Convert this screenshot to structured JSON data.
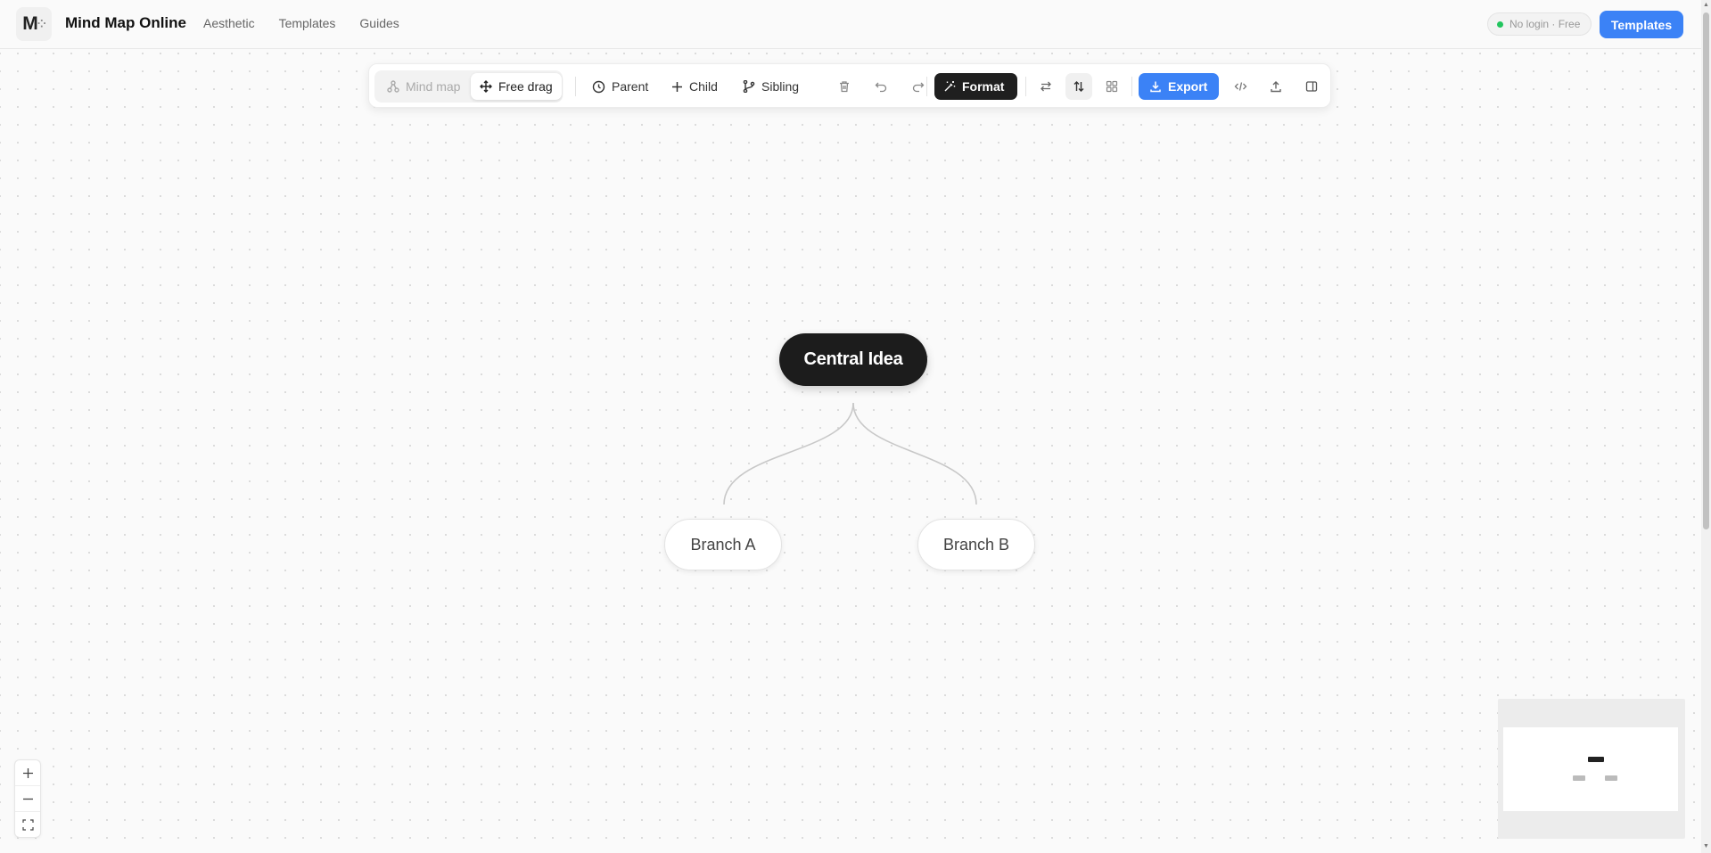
{
  "header": {
    "logo_letter": "M",
    "app_title": "Mind Map Online",
    "nav": [
      "Aesthetic",
      "Templates",
      "Guides"
    ],
    "status": "No login · Free",
    "templates_button": "Templates"
  },
  "toolbar": {
    "mode_mindmap": "Mind map",
    "mode_freedrag": "Free drag",
    "parent": "Parent",
    "child": "Child",
    "sibling": "Sibling",
    "format": "Format",
    "export": "Export",
    "icons": [
      "trash-icon",
      "undo-icon",
      "redo-icon",
      "swap-horizontal-icon",
      "sort-vertical-icon",
      "grid-icon",
      "code-icon",
      "upload-icon",
      "sidebar-icon"
    ]
  },
  "mindmap": {
    "central": "Central Idea",
    "branches": [
      "Branch A",
      "Branch B"
    ]
  },
  "zoom": {
    "icons": [
      "plus-icon",
      "minus-icon",
      "fullscreen-icon"
    ]
  },
  "colors": {
    "accent": "#3b82f6",
    "central_node": "#1c1c1c",
    "status_dot": "#22c55e"
  }
}
